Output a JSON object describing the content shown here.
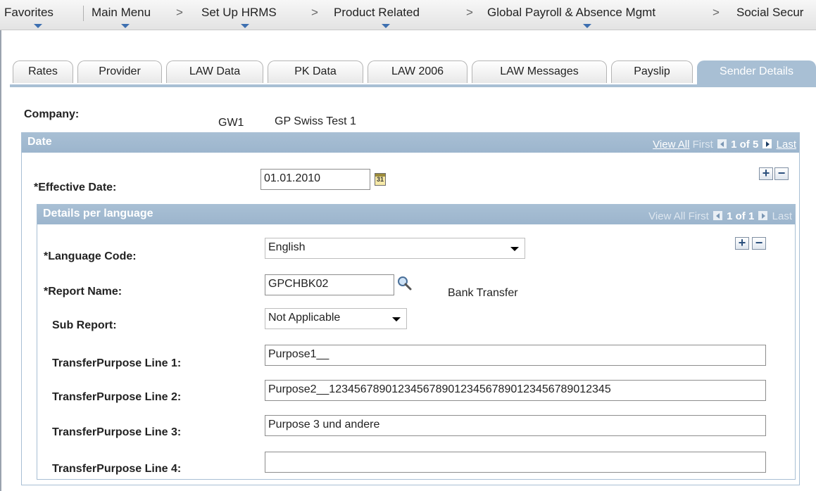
{
  "nav": {
    "favorites": "Favorites",
    "main_menu": "Main Menu",
    "crumbs": [
      "Set Up HRMS",
      "Product Related",
      "Global Payroll & Absence Mgmt",
      "Social Secur"
    ],
    "separator": ">"
  },
  "tabs": [
    {
      "label": "Rates",
      "active": false
    },
    {
      "label": "Provider",
      "active": false
    },
    {
      "label": "LAW Data",
      "active": false
    },
    {
      "label": "PK Data",
      "active": false
    },
    {
      "label": "LAW 2006",
      "active": false
    },
    {
      "label": "LAW Messages",
      "active": false
    },
    {
      "label": "Payslip",
      "active": false
    },
    {
      "label": "Sender Details",
      "active": true
    }
  ],
  "company": {
    "label": "Company:",
    "code": "GW1",
    "name": "GP Swiss Test 1"
  },
  "date_group": {
    "title": "Date",
    "view_all": "View All",
    "first": "First",
    "count": "1 of 5",
    "last": "Last",
    "effective_date_label": "*Effective Date:",
    "effective_date_value": "01.01.2010",
    "calendar_glyph": "31"
  },
  "lang_group": {
    "title": "Details per language",
    "view_all": "View All",
    "first": "First",
    "count": "1 of 1",
    "last": "Last",
    "language_label": "*Language Code:",
    "language_value": "English",
    "report_label": "*Report Name:",
    "report_value": "GPCHBK02",
    "report_desc": "Bank Transfer",
    "sub_report_label": "Sub Report:",
    "sub_report_value": "Not Applicable",
    "purpose_lines": [
      {
        "label": "TransferPurpose Line 1:",
        "value": "Purpose1__"
      },
      {
        "label": "TransferPurpose Line 2:",
        "value": "Purpose2__123456789012345678901234567890123456789012345"
      },
      {
        "label": "TransferPurpose Line 3:",
        "value": "Purpose 3 und andere"
      },
      {
        "label": "TransferPurpose Line 4:",
        "value": ""
      }
    ]
  },
  "buttons": {
    "add": "+",
    "remove": "−"
  },
  "colors": {
    "header_blue": "#a8bfd4",
    "nav_arrow": "#3d6fb0"
  }
}
